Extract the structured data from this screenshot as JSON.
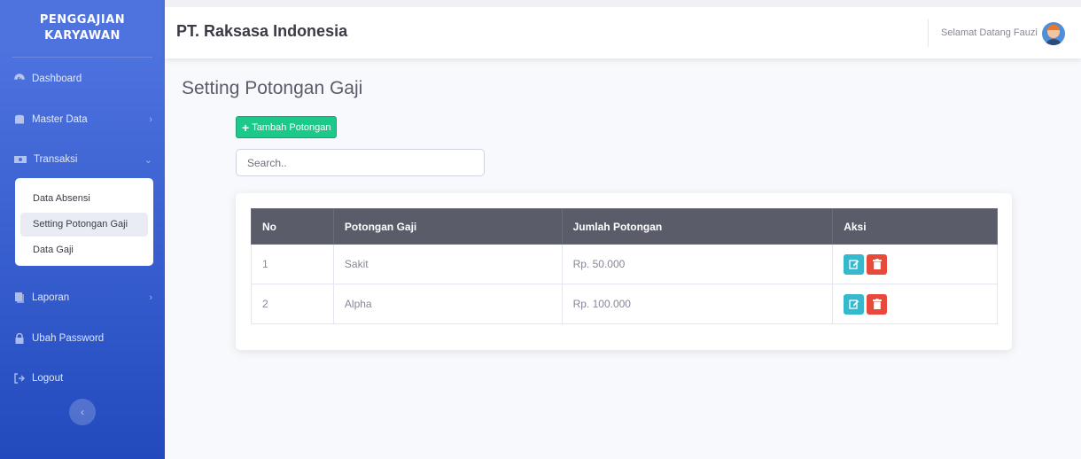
{
  "sidebar": {
    "brand": "PENGGAJIAN KARYAWAN",
    "items": {
      "dashboard": "Dashboard",
      "master": "Master Data",
      "transaksi": "Transaksi",
      "laporan": "Laporan",
      "password": "Ubah Password",
      "logout": "Logout"
    },
    "submenu": [
      "Data Absensi",
      "Setting Potongan Gaji",
      "Data Gaji"
    ],
    "active_submenu": "Setting Potongan Gaji"
  },
  "topbar": {
    "company": "PT. Raksasa Indonesia",
    "welcome": "Selamat Datang Fauzi"
  },
  "main": {
    "title": "Setting Potongan Gaji",
    "add_button": "Tambah Potongan",
    "search_placeholder": "Search..",
    "table": {
      "headers": [
        "No",
        "Potongan Gaji",
        "Jumlah Potongan",
        "Aksi"
      ],
      "rows": [
        {
          "no": "1",
          "potongan": "Sakit",
          "jumlah": "Rp. 50.000"
        },
        {
          "no": "2",
          "potongan": "Alpha",
          "jumlah": "Rp. 100.000"
        }
      ]
    }
  },
  "colors": {
    "sidebar_start": "#4e73df",
    "sidebar_end": "#224abe",
    "success": "#1cc88a",
    "info": "#36b9cc",
    "danger": "#e74a3b",
    "table_header": "#5a5c69"
  }
}
